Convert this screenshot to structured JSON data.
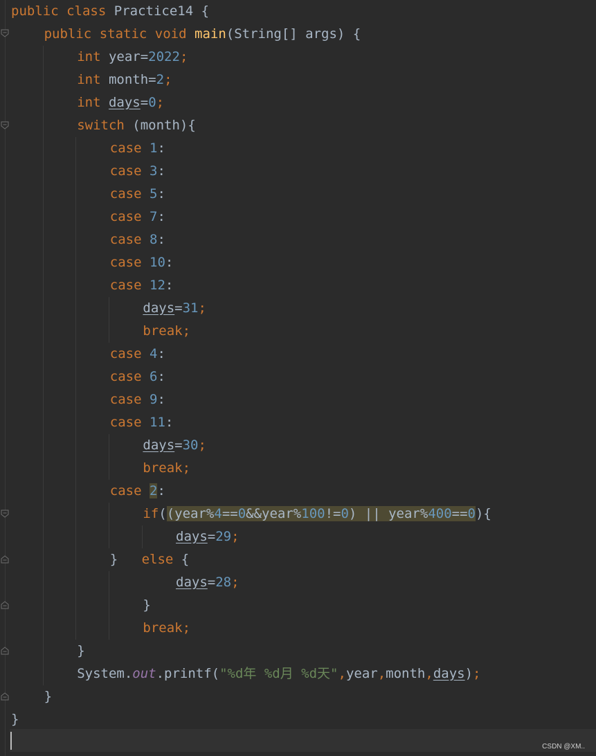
{
  "code": {
    "l1": {
      "kw1": "public",
      "kw2": "class",
      "name": "Practice14",
      "brace": "{"
    },
    "l2": {
      "kw1": "public",
      "kw2": "static",
      "kw3": "void",
      "fn": "main",
      "params": "(String[] args) {"
    },
    "l3": {
      "kw": "int",
      "var": "year=",
      "num": "2022",
      "end": ";"
    },
    "l4": {
      "kw": "int",
      "var": "month=",
      "num": "2",
      "end": ";"
    },
    "l5": {
      "kw": "int",
      "var": "days",
      "eq": "=",
      "num": "0",
      "end": ";"
    },
    "l6": {
      "kw": "switch",
      "rest": "(month){"
    },
    "cases_a": [
      "1",
      "3",
      "5",
      "7",
      "8",
      "10",
      "12"
    ],
    "case_kw": "case",
    "colon": ":",
    "assign31": {
      "var": "days",
      "eq": "=",
      "num": "31",
      "end": ";"
    },
    "break_kw": "break",
    "semi": ";",
    "cases_b": [
      "4",
      "6",
      "9",
      "11"
    ],
    "assign30": {
      "var": "days",
      "eq": "=",
      "num": "30",
      "end": ";"
    },
    "case2": "2",
    "if_line": {
      "kw": "if",
      "p1": "(",
      "p2": "(year%",
      "n4": "4",
      "p3": "==",
      "n0a": "0",
      "p4": "&&year%",
      "n100": "100",
      "p5": "!=",
      "n0b": "0",
      "p6": ") || year%",
      "n400": "400",
      "p7": "==",
      "n0c": "0",
      "p8": "){"
    },
    "assign29": {
      "var": "days",
      "eq": "=",
      "num": "29",
      "end": ";"
    },
    "else_line": {
      "brace": "}",
      "kw": "else",
      "open": "{"
    },
    "assign28": {
      "var": "days",
      "eq": "=",
      "num": "28",
      "end": ";"
    },
    "close": "}",
    "printf": {
      "obj": "System.",
      "fld": "out",
      "call": ".printf(",
      "str": "\"%d年 %d月 %d天\"",
      "comma1": ",",
      "a1": "year",
      "comma2": ",",
      "a2": "month",
      "comma3": ",",
      "a3": "days",
      "end": ")",
      "semi": ";"
    }
  },
  "watermark": "CSDN @XM.."
}
